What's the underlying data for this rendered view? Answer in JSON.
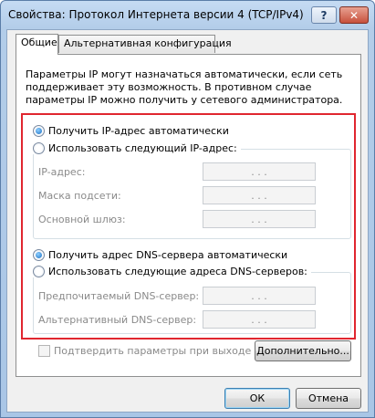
{
  "window": {
    "title": "Свойства: Протокол Интернета версии 4 (TCP/IPv4)",
    "help_label": "?",
    "close_label": "✕"
  },
  "tabs": [
    {
      "label": "Общие",
      "active": true
    },
    {
      "label": "Альтернативная конфигурация",
      "active": false
    }
  ],
  "intro_text": "Параметры IP могут назначаться автоматически, если сеть поддерживает эту возможность. В противном случае параметры IP можно получить у сетевого администратора.",
  "ip_section": {
    "auto_label": "Получить IP-адрес автоматически",
    "auto_selected": true,
    "manual_label": "Использовать следующий IP-адрес:",
    "manual_selected": false,
    "fields": [
      {
        "label": "IP-адрес:",
        "value": ". . ."
      },
      {
        "label": "Маска подсети:",
        "value": ". . ."
      },
      {
        "label": "Основной шлюз:",
        "value": ". . ."
      }
    ]
  },
  "dns_section": {
    "auto_label": "Получить адрес DNS-сервера автоматически",
    "auto_selected": true,
    "manual_label": "Использовать следующие адреса DNS-серверов:",
    "manual_selected": false,
    "fields": [
      {
        "label": "Предпочитаемый DNS-сервер:",
        "value": ". . ."
      },
      {
        "label": "Альтернативный DNS-сервер:",
        "value": ". . ."
      }
    ]
  },
  "validate_checkbox": {
    "label": "Подтвердить параметры при выходе",
    "checked": false,
    "enabled": false
  },
  "buttons": {
    "advanced": "Дополнительно...",
    "ok": "ОК",
    "cancel": "Отмена"
  },
  "colors": {
    "highlight_frame": "#e0262f",
    "title_bar": "#b3cde9"
  }
}
